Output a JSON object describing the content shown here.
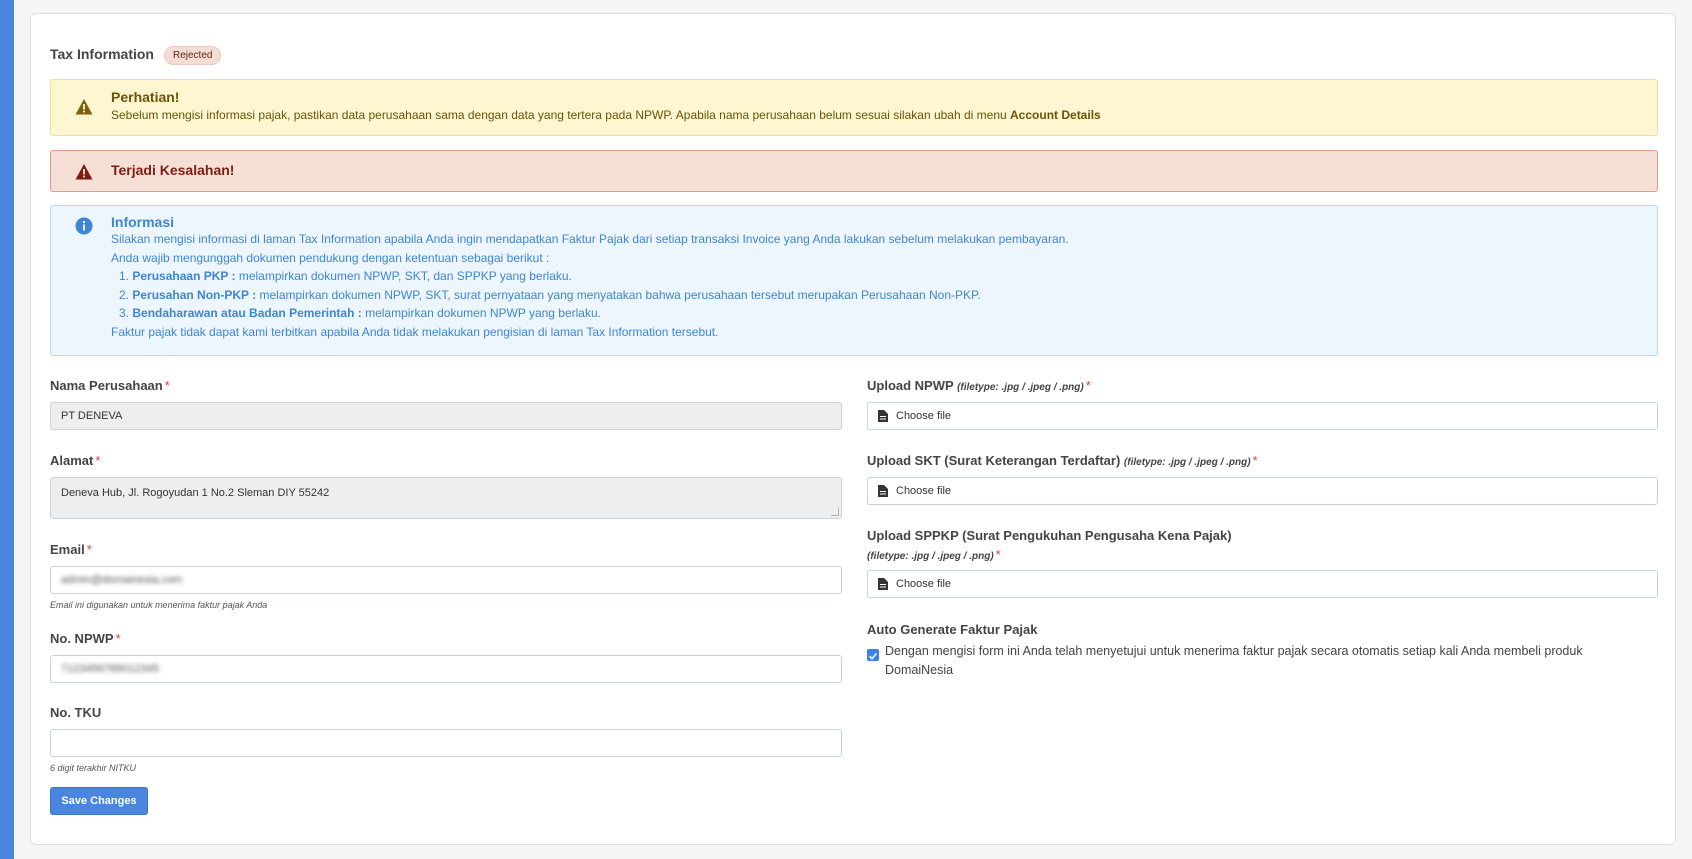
{
  "header": {
    "title": "Tax Information",
    "status_badge": "Rejected"
  },
  "alerts": {
    "warning": {
      "title": "Perhatian!",
      "text": "Sebelum mengisi informasi pajak, pastikan data perusahaan sama dengan data yang tertera pada NPWP. Apabila nama perusahaan belum sesuai silakan ubah di menu ",
      "link_text": "Account Details"
    },
    "danger": {
      "title": "Terjadi Kesalahan!"
    },
    "info": {
      "title": "Informasi",
      "line1": "Silakan mengisi informasi di laman Tax Information apabila Anda ingin mendapatkan Faktur Pajak dari setiap transaksi Invoice yang Anda lakukan sebelum melakukan pembayaran.",
      "line2": "Anda wajib mengunggah dokumen pendukung dengan ketentuan sebagai berikut :",
      "items": [
        {
          "num": "1.",
          "bold": "Perusahaan PKP :",
          "text": " melampirkan dokumen NPWP, SKT, dan SPPKP yang berlaku."
        },
        {
          "num": "2.",
          "bold": "Perusahan Non-PKP :",
          "text": " melampirkan dokumen NPWP, SKT, surat pernyataan yang menyatakan bahwa perusahaan tersebut merupakan Perusahaan Non-PKP."
        },
        {
          "num": "3.",
          "bold": "Bendaharawan atau Badan Pemerintah :",
          "text": " melampirkan dokumen NPWP yang berlaku."
        }
      ],
      "line3": "Faktur pajak tidak dapat kami terbitkan apabila Anda tidak melakukan pengisian di laman Tax Information tersebut."
    }
  },
  "form": {
    "company_name": {
      "label": "Nama Perusahaan",
      "required": "*",
      "value": "PT DENEVA"
    },
    "address": {
      "label": "Alamat",
      "required": "*",
      "value": "Deneva Hub, Jl. Rogoyudan 1 No.2  Sleman DIY 55242"
    },
    "email": {
      "label": "Email",
      "required": "*",
      "value": "admin@domainesia.com",
      "hint": "Email ini digunakan untuk menerima faktur pajak Anda"
    },
    "npwp": {
      "label": "No. NPWP",
      "required": "*",
      "value": "7123456789012345"
    },
    "tku": {
      "label": "No. TKU",
      "value": "",
      "hint": "6 digit terakhir NITKU"
    },
    "upload_npwp": {
      "label": "Upload NPWP",
      "filetype": "(filetype: .jpg / .jpeg / .png)",
      "required": "*",
      "button": "Choose file"
    },
    "upload_skt": {
      "label": "Upload SKT (Surat Keterangan Terdaftar)",
      "filetype": "(filetype: .jpg / .jpeg / .png)",
      "required": "*",
      "button": "Choose file"
    },
    "upload_sppkp": {
      "label": "Upload SPPKP (Surat Pengukuhan Pengusaha Kena Pajak)",
      "filetype": "(filetype: .jpg / .jpeg / .png)",
      "required": "*",
      "button": "Choose file"
    },
    "auto_generate": {
      "label": "Auto Generate Faktur Pajak",
      "checked": true,
      "text_line1": "Dengan mengisi form ini Anda telah menyetujui untuk menerima faktur pajak secara otomatis setiap kali Anda membeli produk",
      "text_line2": "DomaiNesia"
    },
    "save_button": "Save Changes"
  },
  "colors": {
    "accent": "#4a86e0",
    "warning_bg": "#fdf6d0",
    "danger_bg": "#f6dfd5",
    "info_bg": "#edf5fd",
    "required": "#d9433a"
  }
}
